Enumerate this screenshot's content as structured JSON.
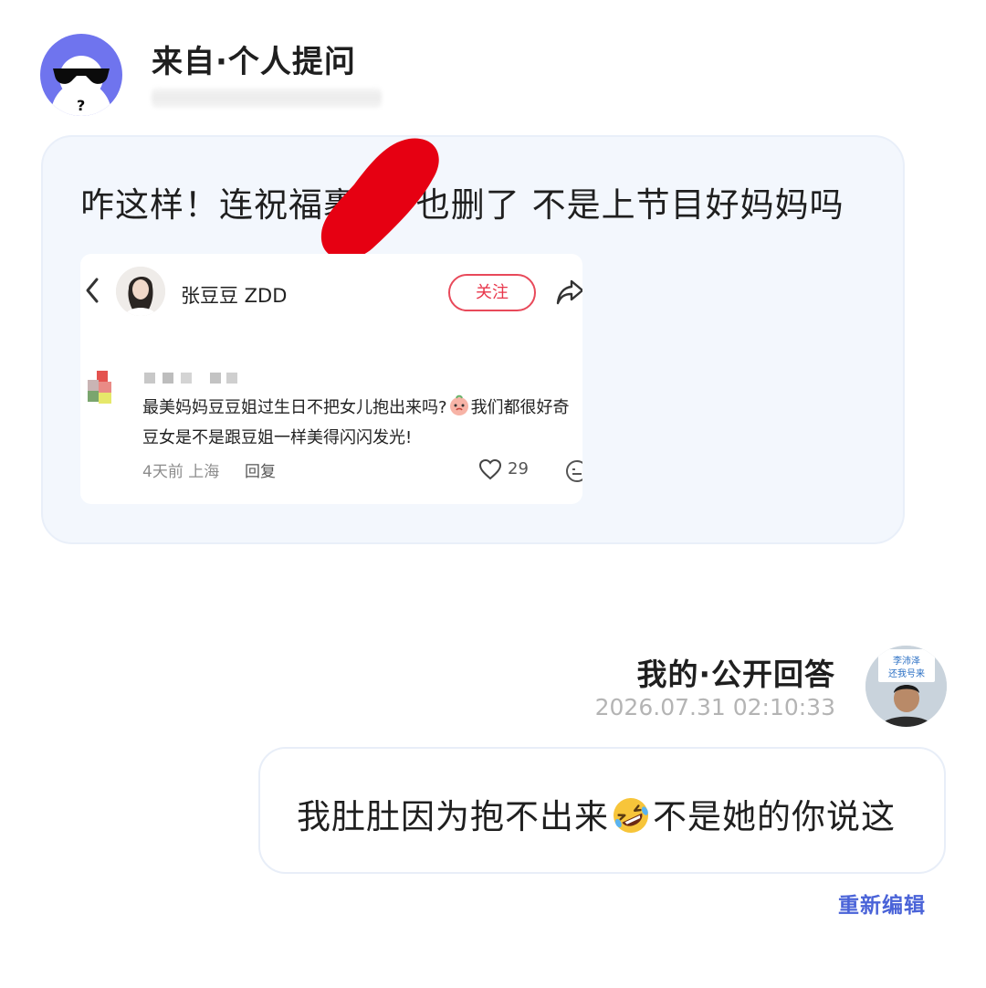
{
  "question": {
    "title": "来自·个人提问",
    "avatar_icon": "anonymous-sunglasses-avatar-icon",
    "text": "咋这样！连祝福裹⬛也删了 不是上节目好妈妈吗",
    "text_visible": "咋这样！连祝福裹     也删了 不是上节目好妈妈吗",
    "colors": {
      "avatar_bg": "#6f74ee",
      "bubble_bg": "#f3f7fd",
      "redaction": "#e60012"
    }
  },
  "embedded_post": {
    "author_name": "张豆豆 ZDD",
    "follow_label": "关注",
    "comment": {
      "text_part1": "最美妈妈豆豆姐过生日不把女儿抱出来吗?",
      "text_part2": "我们都很好奇豆女是不是跟豆姐一样美得闪闪发光!",
      "meta": "4天前 上海",
      "reply_label": "回复",
      "likes": "29"
    },
    "colors": {
      "follow": "#e8364b"
    }
  },
  "answer": {
    "title": "我的·公开回答",
    "timestamp": "2026.07.31 02:10:33",
    "text_part1": "我肚肚因为抱不出来",
    "text_part2": "不是她的你说这",
    "emoji_icon": "rolling-on-floor-laughing-emoji-icon",
    "avatar_sign": "李沛泽\n还我号来",
    "reedit_label": "重新编辑",
    "colors": {
      "reedit": "#4a63d8",
      "time": "#b4b4b4"
    }
  }
}
